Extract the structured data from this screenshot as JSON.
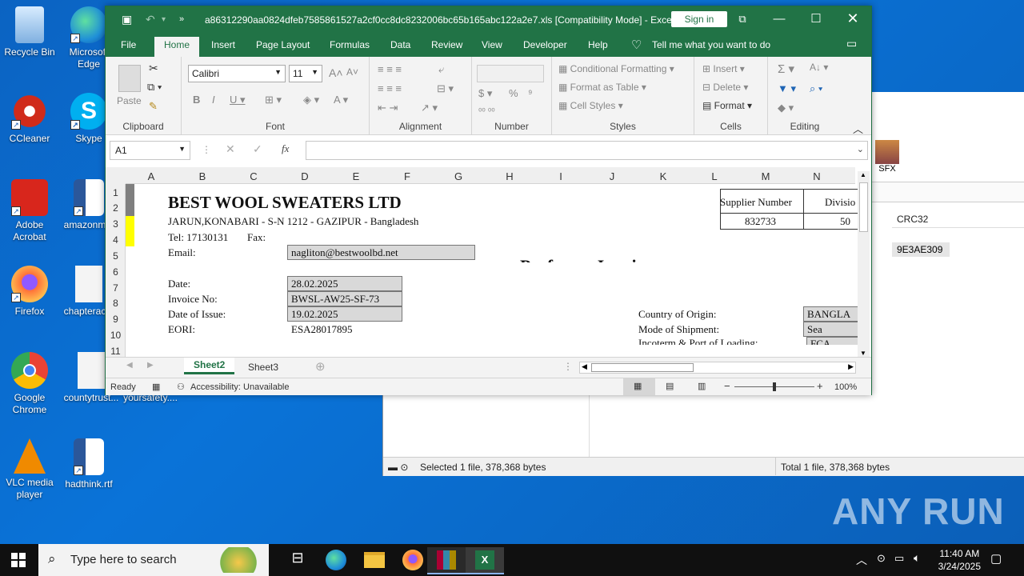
{
  "desktop": {
    "icons": [
      {
        "label": "Recycle Bin",
        "icon": "recycle-bin-icon",
        "color": "#8fc1ff"
      },
      {
        "label": "Microsoft Edge",
        "icon": "edge-icon",
        "color": "#1fa3d8"
      },
      {
        "label": "CCleaner",
        "icon": "ccleaner-icon",
        "color": "#d02b1a"
      },
      {
        "label": "Skype",
        "icon": "skype-icon",
        "color": "#00aff0"
      },
      {
        "label": "Adobe Acrobat",
        "icon": "acrobat-icon",
        "color": "#d8261c"
      },
      {
        "label": "amazonm...",
        "icon": "word-doc-icon",
        "color": "#2b579a"
      },
      {
        "label": "Firefox",
        "icon": "firefox-icon",
        "color": "#ff7139"
      },
      {
        "label": "chapterac...",
        "icon": "image-file-icon",
        "color": "#e8e8e8"
      },
      {
        "label": "Google Chrome",
        "icon": "chrome-icon",
        "color": "#34a853"
      },
      {
        "label": "countytrust...",
        "icon": "image-file-icon",
        "color": "#e8e8e8"
      },
      {
        "label": "yoursafety....",
        "icon": "image-file-icon",
        "color": "#e8e8e8"
      },
      {
        "label": "VLC media player",
        "icon": "vlc-icon",
        "color": "#f08a00"
      },
      {
        "label": "hadthink.rtf",
        "icon": "word-doc-icon",
        "color": "#2b579a"
      }
    ]
  },
  "bgwindow": {
    "sfx_label": "SFX",
    "crc_header": "CRC32",
    "crc_value": "9E3AE309",
    "status_left": "Selected 1 file, 378,368 bytes",
    "status_right": "Total 1 file, 378,368 bytes"
  },
  "excel": {
    "title": "a86312290aa0824dfeb7585861527a2cf0cc8dc8232006bc65b165abc122a2e7.xls  [Compatibility Mode]  -  Excel",
    "sign_in": "Sign in",
    "tabs": [
      "File",
      "Home",
      "Insert",
      "Page Layout",
      "Formulas",
      "Data",
      "Review",
      "View",
      "Developer",
      "Help"
    ],
    "tell_me": "Tell me what you want to do",
    "ribbon": {
      "clipboard": {
        "label": "Clipboard",
        "paste": "Paste"
      },
      "font": {
        "label": "Font",
        "name": "Calibri",
        "size": "11"
      },
      "alignment": {
        "label": "Alignment"
      },
      "number": {
        "label": "Number"
      },
      "styles": {
        "label": "Styles",
        "conditional": "Conditional Formatting",
        "table": "Format as Table",
        "cell": "Cell Styles"
      },
      "cells": {
        "label": "Cells",
        "insert": "Insert",
        "delete": "Delete",
        "format": "Format"
      },
      "editing": {
        "label": "Editing"
      }
    },
    "namebox": "A1",
    "fx_label": "fx",
    "columns": [
      "A",
      "B",
      "C",
      "D",
      "E",
      "F",
      "G",
      "H",
      "I",
      "J",
      "K",
      "L",
      "M",
      "N"
    ],
    "rows": [
      "1",
      "2",
      "3",
      "4",
      "5",
      "6",
      "7",
      "8",
      "9",
      "10",
      "11"
    ],
    "doc": {
      "company": "BEST WOOL SWEATERS LTD",
      "address": "JARUN,KONABARI - S-N 1212 - GAZIPUR - Bangladesh",
      "tel": "Tel: 17130131",
      "fax": "Fax:",
      "email_label": "Email:",
      "email": "nagliton@bestwoolbd.net",
      "heading": "Proforma Invoice",
      "supplier_number_label": "Supplier Number",
      "supplier_number": "832733",
      "division_label": "Divisio",
      "division": "50",
      "date_label": "Date:",
      "date": "28.02.2025",
      "invoice_label": "Invoice No:",
      "invoice": "BWSL-AW25-SF-73",
      "issue_label": "Date of Issue:",
      "issue": "19.02.2025",
      "eori_label": "EORI:",
      "eori": "ESA28017895",
      "origin_label": "Country of Origin:",
      "origin": "BANGLA",
      "shipment_label": "Mode of Shipment:",
      "shipment": "Sea",
      "incoterm_label": "Incoterm & Port of Loading:",
      "incoterm": "FCA"
    },
    "sheets": [
      "Sheet2",
      "Sheet3"
    ],
    "status": {
      "ready": "Ready",
      "accessibility": "Accessibility: Unavailable",
      "zoom": "100%"
    },
    "zoom_level": 1.0
  },
  "taskbar": {
    "search_placeholder": "Type here to search",
    "time": "11:40 AM",
    "date": "3/24/2025"
  },
  "watermark": "ANY RUN",
  "colors": {
    "excel_green": "#217346",
    "desktop_blue": "#0a6cd0"
  }
}
